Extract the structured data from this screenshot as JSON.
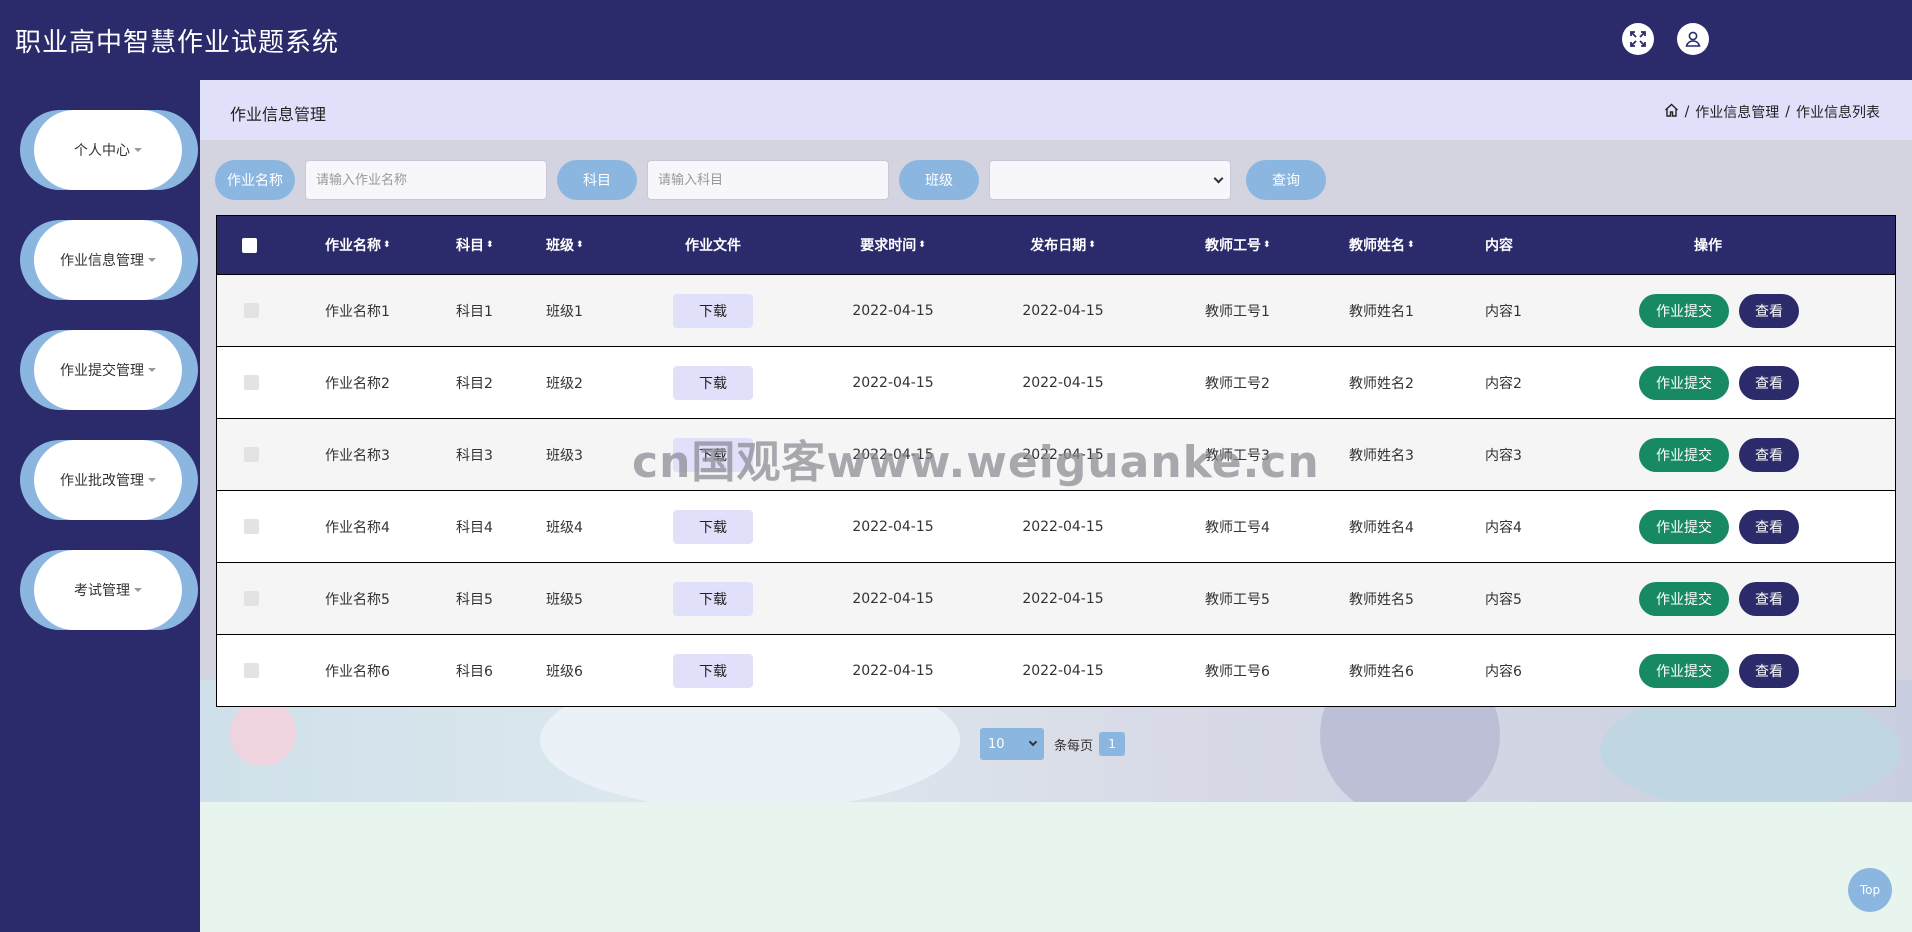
{
  "app": {
    "title": "职业高中智慧作业试题系统"
  },
  "header": {
    "icons": [
      "fullscreen-icon",
      "user-icon"
    ]
  },
  "sidebar": {
    "items": [
      {
        "label": "个人中心"
      },
      {
        "label": "作业信息管理"
      },
      {
        "label": "作业提交管理"
      },
      {
        "label": "作业批改管理"
      },
      {
        "label": "考试管理"
      }
    ]
  },
  "page": {
    "title": "作业信息管理",
    "breadcrumb": [
      "作业信息管理",
      "作业信息列表"
    ],
    "separator": "/"
  },
  "search": {
    "name_label": "作业名称",
    "name_placeholder": "请输入作业名称",
    "subject_label": "科目",
    "subject_placeholder": "请输入科目",
    "class_label": "班级",
    "class_value": "",
    "query_label": "查询"
  },
  "table": {
    "headers": {
      "name": "作业名称",
      "subject": "科目",
      "class": "班级",
      "file": "作业文件",
      "due": "要求时间",
      "publish": "发布日期",
      "teacher_id": "教师工号",
      "teacher_name": "教师姓名",
      "content": "内容",
      "actions": "操作"
    },
    "download_label": "下载",
    "submit_label": "作业提交",
    "view_label": "查看",
    "rows": [
      {
        "name": "作业名称1",
        "subject": "科目1",
        "class": "班级1",
        "due": "2022-04-15",
        "publish": "2022-04-15",
        "teacher_id": "教师工号1",
        "teacher_name": "教师姓名1",
        "content": "内容1"
      },
      {
        "name": "作业名称2",
        "subject": "科目2",
        "class": "班级2",
        "due": "2022-04-15",
        "publish": "2022-04-15",
        "teacher_id": "教师工号2",
        "teacher_name": "教师姓名2",
        "content": "内容2"
      },
      {
        "name": "作业名称3",
        "subject": "科目3",
        "class": "班级3",
        "due": "2022-04-15",
        "publish": "2022-04-15",
        "teacher_id": "教师工号3",
        "teacher_name": "教师姓名3",
        "content": "内容3"
      },
      {
        "name": "作业名称4",
        "subject": "科目4",
        "class": "班级4",
        "due": "2022-04-15",
        "publish": "2022-04-15",
        "teacher_id": "教师工号4",
        "teacher_name": "教师姓名4",
        "content": "内容4"
      },
      {
        "name": "作业名称5",
        "subject": "科目5",
        "class": "班级5",
        "due": "2022-04-15",
        "publish": "2022-04-15",
        "teacher_id": "教师工号5",
        "teacher_name": "教师姓名5",
        "content": "内容5"
      },
      {
        "name": "作业名称6",
        "subject": "科目6",
        "class": "班级6",
        "due": "2022-04-15",
        "publish": "2022-04-15",
        "teacher_id": "教师工号6",
        "teacher_name": "教师姓名6",
        "content": "内容6"
      }
    ]
  },
  "pagination": {
    "page_size": "10",
    "per_page_label": "条每页",
    "current_page": "1"
  },
  "watermark": "cn国观客www.weiguanke.cn",
  "back_to_top": "Top",
  "colors": {
    "primary": "#2b2a6b",
    "accent": "#8bb6e0",
    "submit": "#178a63",
    "header_band": "#e0e0fb"
  }
}
